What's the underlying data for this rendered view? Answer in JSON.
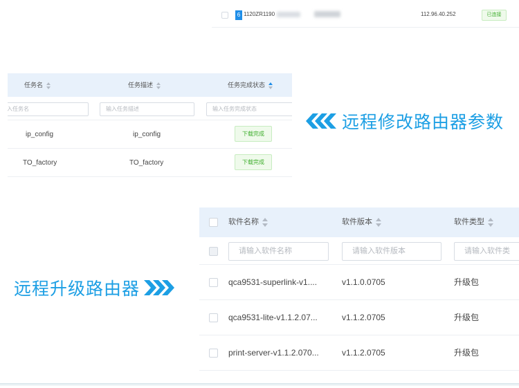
{
  "device_row": {
    "index": "6",
    "serial": "1120ZR1190",
    "ip": "112.96.40.252",
    "status": "已连接"
  },
  "task_table": {
    "headers": [
      "任务名",
      "任务描述",
      "任务完成状态"
    ],
    "sorted_column": "任务完成状态",
    "filter_placeholders": [
      "入任务名",
      "输入任务描述",
      "输入任务完成状态"
    ],
    "rows": [
      {
        "name": "ip_config",
        "description": "ip_config",
        "status": "下载完成"
      },
      {
        "name": "TO_factory",
        "description": "TO_factory",
        "status": "下载完成"
      }
    ]
  },
  "banner_remote_modify": "远程修改路由器参数",
  "banner_remote_upgrade": "远程升级路由器",
  "software_table": {
    "headers": [
      "软件名称",
      "软件版本",
      "软件类型"
    ],
    "filter_placeholders": [
      "请输入软件名称",
      "请输入软件版本",
      "请输入软件类"
    ],
    "rows": [
      {
        "name": "qca9531-superlink-v1....",
        "version": "v1.1.0.0705",
        "type": "升级包"
      },
      {
        "name": "qca9531-lite-v1.1.2.07...",
        "version": "v1.1.2.0705",
        "type": "升级包"
      },
      {
        "name": "print-server-v1.1.2.070...",
        "version": "v1.1.2.0705",
        "type": "升级包"
      }
    ]
  },
  "colors": {
    "accent": "#1d9fe4",
    "header_bg": "#e8f1fb",
    "success_text": "#3fae2e",
    "success_bg": "#effaeb"
  }
}
